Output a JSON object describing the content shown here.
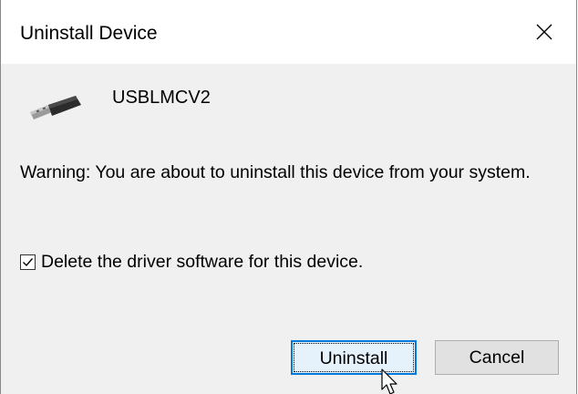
{
  "dialog": {
    "title": "Uninstall Device",
    "close_icon": "close-icon",
    "device": {
      "icon": "usb-connector-icon",
      "name": "USBLMCV2"
    },
    "warning": "Warning: You are about to uninstall this device from your system.",
    "delete_driver": {
      "label": "Delete the driver software for this device.",
      "checked": true
    },
    "buttons": {
      "uninstall_label": "Uninstall",
      "cancel_label": "Cancel"
    }
  },
  "colors": {
    "dialog_background": "#f0f0f0",
    "titlebar_background": "#ffffff",
    "default_button_border": "#0078d7",
    "default_button_fill": "#e5f1fb",
    "button_fill": "#e1e1e1"
  },
  "cursor": "arrow-pointer-icon"
}
